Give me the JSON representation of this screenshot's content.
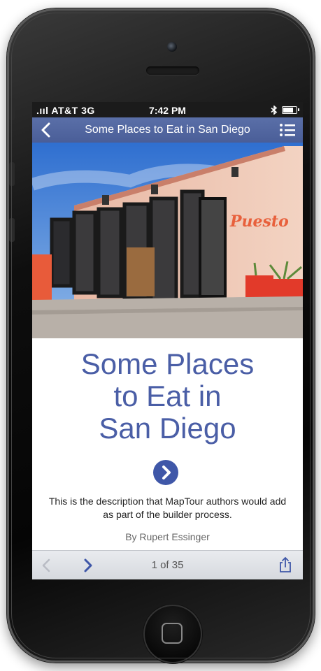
{
  "status_bar": {
    "carrier": ".ııl AT&T  3G",
    "time": "7:42 PM",
    "bluetooth_icon": "bluetooth-icon",
    "battery_icon": "battery-icon"
  },
  "nav_bar": {
    "title": "Some Places to Eat in San Diego",
    "back_icon": "chevron-left-icon",
    "menu_icon": "list-menu-icon"
  },
  "hero": {
    "sign_text": "Puesto"
  },
  "main": {
    "title": "Some Places to Eat in San Diego",
    "title_lines": [
      "Some Places",
      "to Eat in",
      "San Diego"
    ],
    "go_icon": "chevron-right-circle-icon",
    "description": "This is the description that MapTour authors would add as part of the builder process.",
    "byline": "By Rupert Essinger"
  },
  "toolbar": {
    "page_indicator": "1 of 35",
    "prev_icon": "chevron-left-icon",
    "next_icon": "chevron-right-icon",
    "share_icon": "share-icon"
  },
  "colors": {
    "accent": "#4a5ea6",
    "nav_bar": "#5266a0",
    "status_bar": "#1b1b1b",
    "toolbar": "#e0e3e8"
  }
}
